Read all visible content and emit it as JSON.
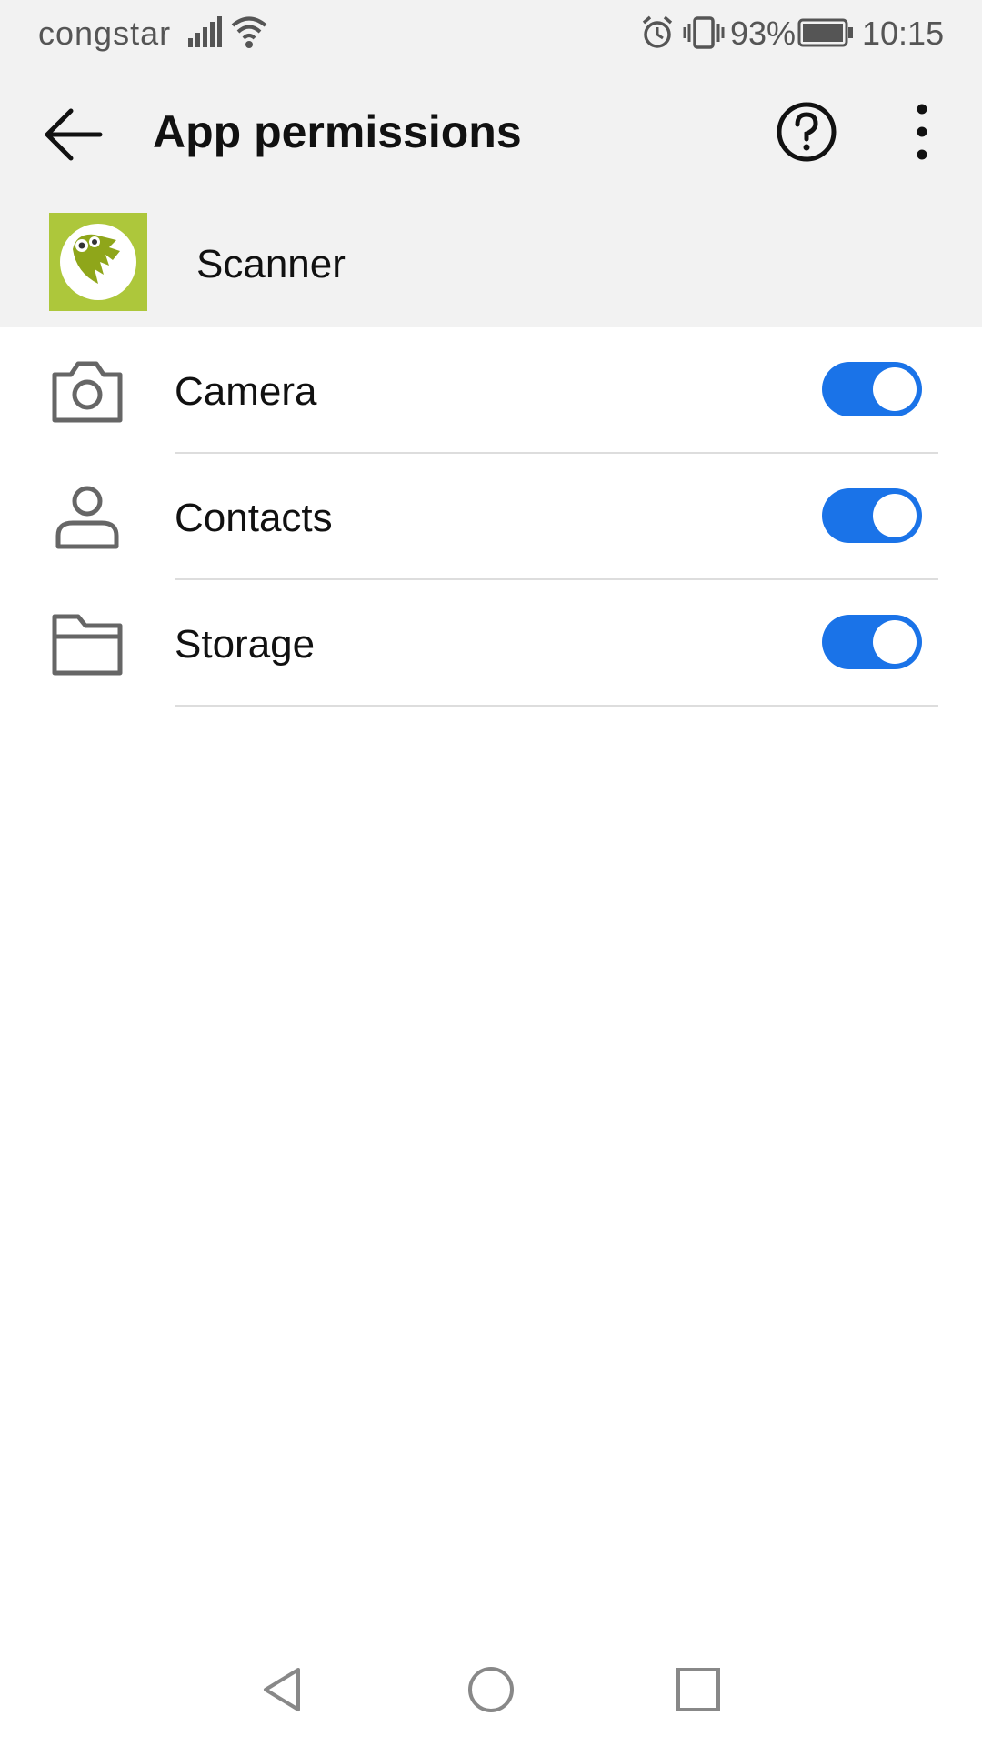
{
  "status_bar": {
    "carrier": "congstar",
    "battery_percent": "93%",
    "time": "10:15",
    "icons": [
      "signal-icon",
      "wifi-icon",
      "alarm-icon",
      "vibrate-icon",
      "battery-icon"
    ]
  },
  "app_bar": {
    "title": "App permissions",
    "back_icon": "arrow-back-icon",
    "help_icon": "help-circle-icon",
    "more_icon": "more-vert-icon"
  },
  "app_header": {
    "app_name": "Scanner",
    "icon": "scanner-app-icon",
    "icon_bg_color": "#adc73b"
  },
  "permissions": [
    {
      "label": "Camera",
      "icon": "camera-icon",
      "enabled": true
    },
    {
      "label": "Contacts",
      "icon": "person-icon",
      "enabled": true
    },
    {
      "label": "Storage",
      "icon": "folder-icon",
      "enabled": true
    }
  ],
  "colors": {
    "accent": "#1a73e8",
    "header_bg": "#f2f2f2"
  },
  "nav_bar": {
    "icons": [
      "nav-back-icon",
      "nav-home-icon",
      "nav-recents-icon"
    ]
  }
}
